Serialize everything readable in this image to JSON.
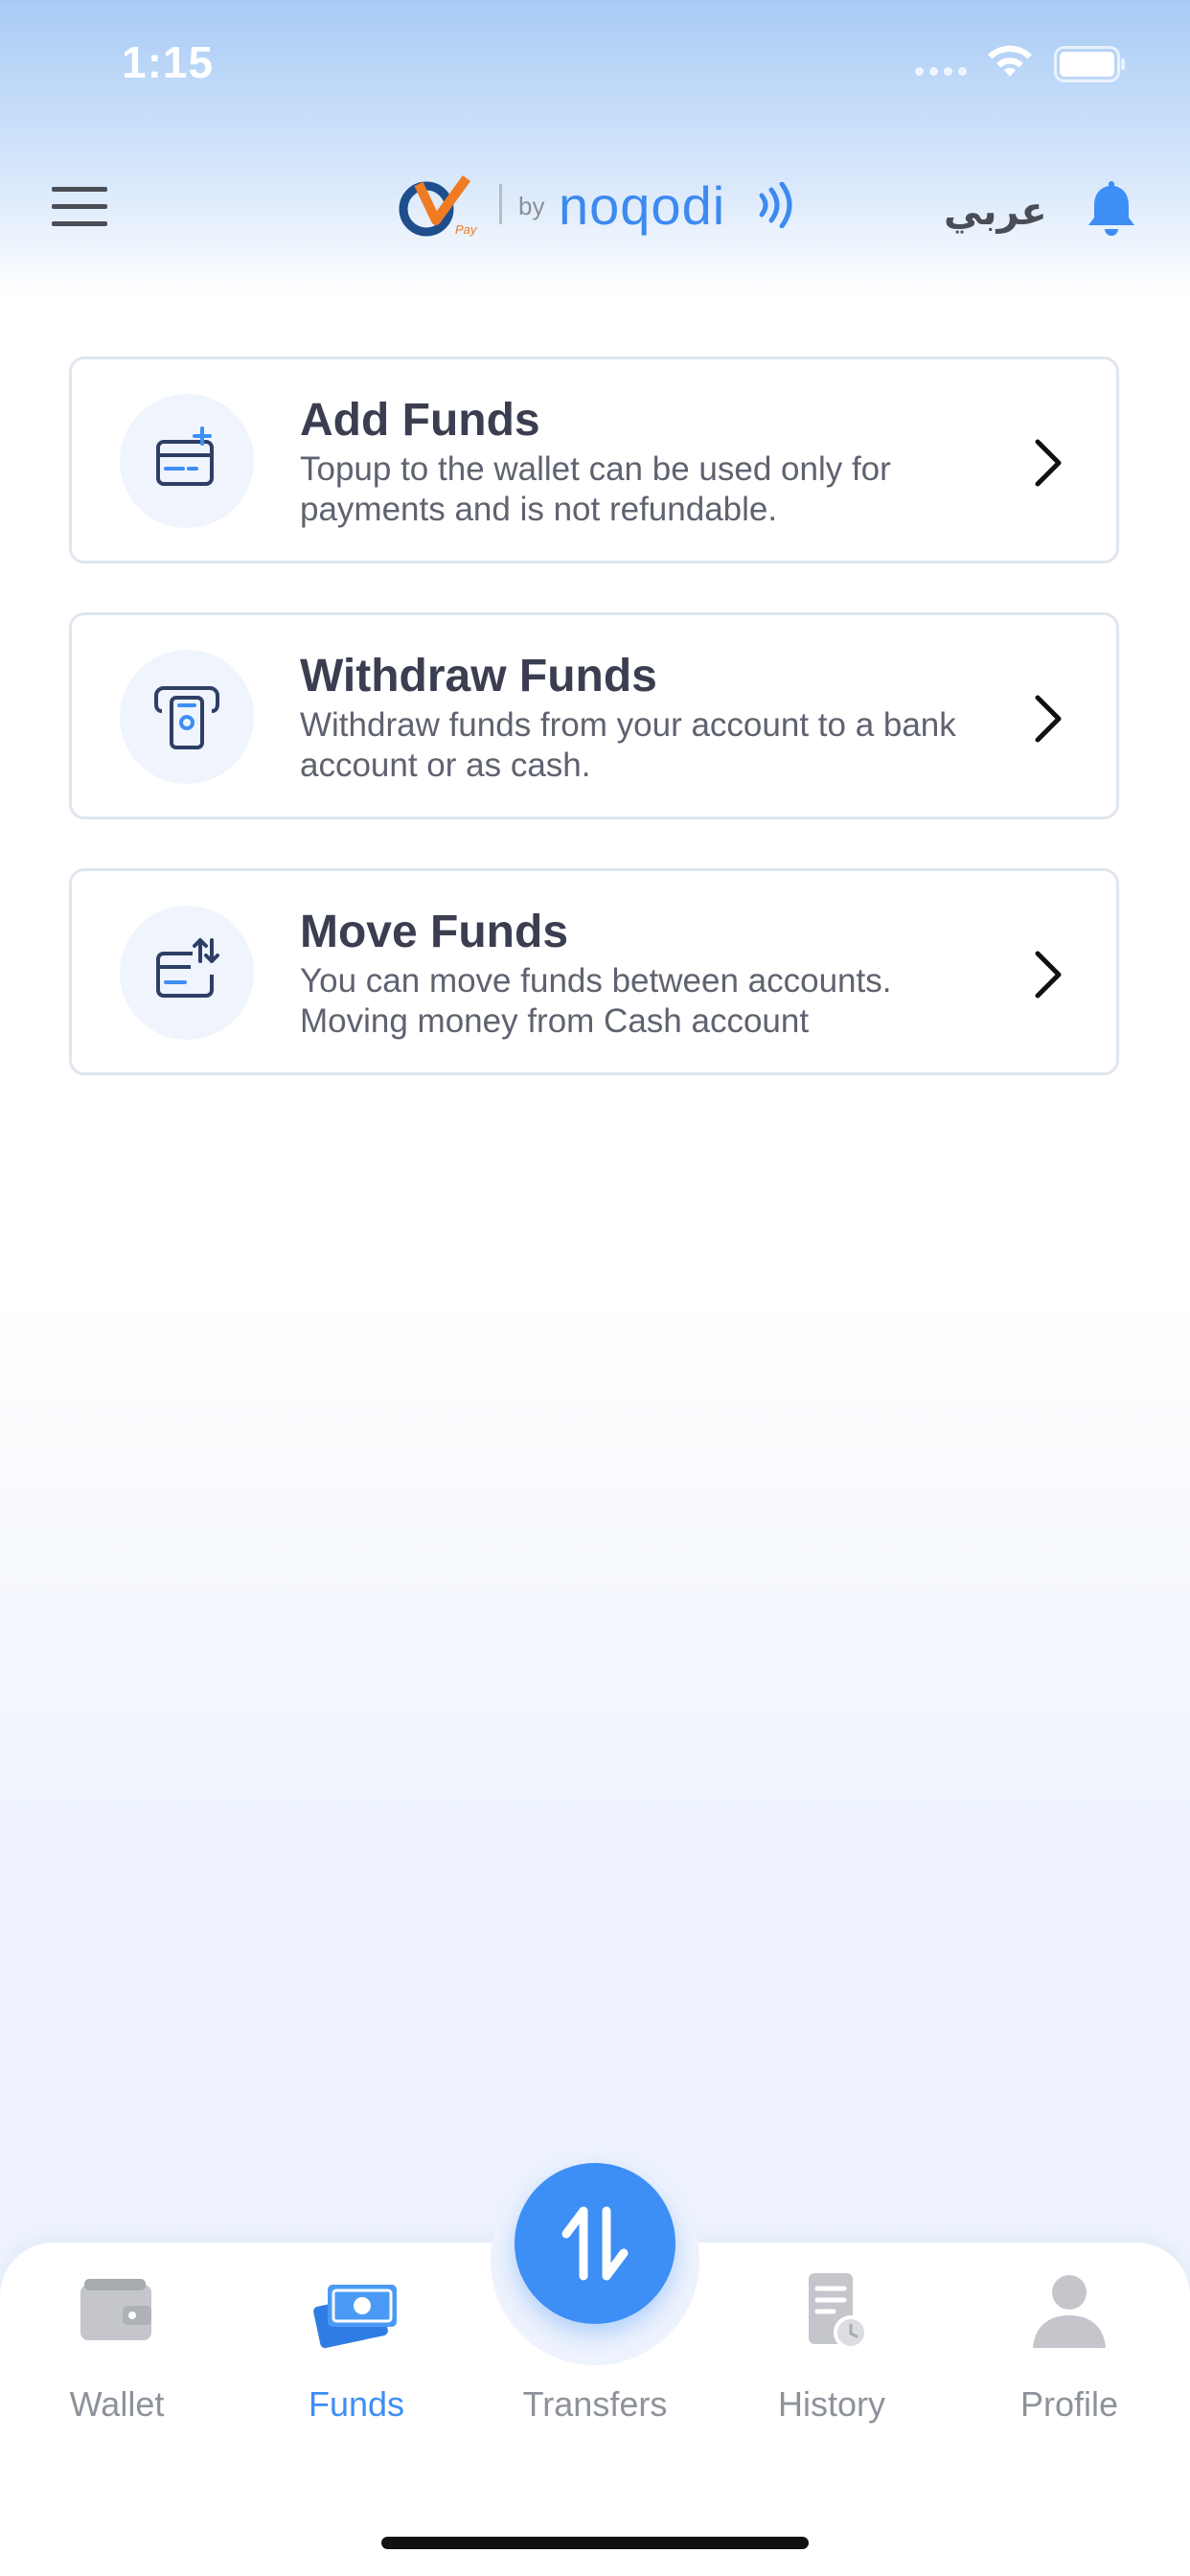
{
  "status_bar": {
    "time": "1:15",
    "icons": [
      "signal-dots-icon",
      "wifi-icon",
      "battery-icon"
    ]
  },
  "header": {
    "menu_icon": "hamburger-menu-icon",
    "logo": {
      "by_text": "by",
      "brand_text": "noqodi",
      "mark_text": "Pay"
    },
    "language_link": "عربي",
    "notification_icon": "bell-icon"
  },
  "cards": [
    {
      "title": "Add Funds",
      "description": "Topup to the wallet can be used only for payments and is not refundable.",
      "icon": "card-plus-icon"
    },
    {
      "title": "Withdraw Funds",
      "description": "Withdraw funds from your account to a bank account or as cash.",
      "icon": "atm-cash-icon"
    },
    {
      "title": "Move Funds",
      "description": "You can move funds between accounts. Moving money from Cash account",
      "icon": "card-transfer-icon"
    }
  ],
  "bottom_nav": {
    "active": "Funds",
    "items": [
      {
        "label": "Wallet",
        "icon": "wallet-icon"
      },
      {
        "label": "Funds",
        "icon": "cash-icon"
      },
      {
        "label": "Transfers",
        "icon": "transfer-arrows-icon"
      },
      {
        "label": "History",
        "icon": "history-document-icon"
      },
      {
        "label": "Profile",
        "icon": "profile-person-icon"
      }
    ]
  },
  "colors": {
    "accent": "#3d8ef5",
    "brand_blue": "#3d8af0",
    "text_dark": "#3b3e50",
    "text_muted": "#8d929a",
    "card_border": "#dfe6ef"
  }
}
